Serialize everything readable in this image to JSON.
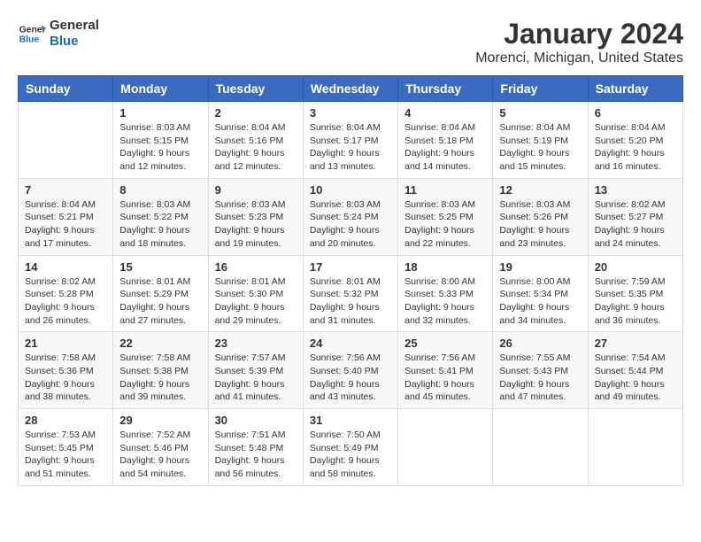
{
  "logo": {
    "line1": "General",
    "line2": "Blue"
  },
  "title": "January 2024",
  "subtitle": "Morenci, Michigan, United States",
  "headers": [
    "Sunday",
    "Monday",
    "Tuesday",
    "Wednesday",
    "Thursday",
    "Friday",
    "Saturday"
  ],
  "weeks": [
    [
      {
        "day": "",
        "info": ""
      },
      {
        "day": "1",
        "info": "Sunrise: 8:03 AM\nSunset: 5:15 PM\nDaylight: 9 hours\nand 12 minutes."
      },
      {
        "day": "2",
        "info": "Sunrise: 8:04 AM\nSunset: 5:16 PM\nDaylight: 9 hours\nand 12 minutes."
      },
      {
        "day": "3",
        "info": "Sunrise: 8:04 AM\nSunset: 5:17 PM\nDaylight: 9 hours\nand 13 minutes."
      },
      {
        "day": "4",
        "info": "Sunrise: 8:04 AM\nSunset: 5:18 PM\nDaylight: 9 hours\nand 14 minutes."
      },
      {
        "day": "5",
        "info": "Sunrise: 8:04 AM\nSunset: 5:19 PM\nDaylight: 9 hours\nand 15 minutes."
      },
      {
        "day": "6",
        "info": "Sunrise: 8:04 AM\nSunset: 5:20 PM\nDaylight: 9 hours\nand 16 minutes."
      }
    ],
    [
      {
        "day": "7",
        "info": "Sunrise: 8:04 AM\nSunset: 5:21 PM\nDaylight: 9 hours\nand 17 minutes."
      },
      {
        "day": "8",
        "info": "Sunrise: 8:03 AM\nSunset: 5:22 PM\nDaylight: 9 hours\nand 18 minutes."
      },
      {
        "day": "9",
        "info": "Sunrise: 8:03 AM\nSunset: 5:23 PM\nDaylight: 9 hours\nand 19 minutes."
      },
      {
        "day": "10",
        "info": "Sunrise: 8:03 AM\nSunset: 5:24 PM\nDaylight: 9 hours\nand 20 minutes."
      },
      {
        "day": "11",
        "info": "Sunrise: 8:03 AM\nSunset: 5:25 PM\nDaylight: 9 hours\nand 22 minutes."
      },
      {
        "day": "12",
        "info": "Sunrise: 8:03 AM\nSunset: 5:26 PM\nDaylight: 9 hours\nand 23 minutes."
      },
      {
        "day": "13",
        "info": "Sunrise: 8:02 AM\nSunset: 5:27 PM\nDaylight: 9 hours\nand 24 minutes."
      }
    ],
    [
      {
        "day": "14",
        "info": "Sunrise: 8:02 AM\nSunset: 5:28 PM\nDaylight: 9 hours\nand 26 minutes."
      },
      {
        "day": "15",
        "info": "Sunrise: 8:01 AM\nSunset: 5:29 PM\nDaylight: 9 hours\nand 27 minutes."
      },
      {
        "day": "16",
        "info": "Sunrise: 8:01 AM\nSunset: 5:30 PM\nDaylight: 9 hours\nand 29 minutes."
      },
      {
        "day": "17",
        "info": "Sunrise: 8:01 AM\nSunset: 5:32 PM\nDaylight: 9 hours\nand 31 minutes."
      },
      {
        "day": "18",
        "info": "Sunrise: 8:00 AM\nSunset: 5:33 PM\nDaylight: 9 hours\nand 32 minutes."
      },
      {
        "day": "19",
        "info": "Sunrise: 8:00 AM\nSunset: 5:34 PM\nDaylight: 9 hours\nand 34 minutes."
      },
      {
        "day": "20",
        "info": "Sunrise: 7:59 AM\nSunset: 5:35 PM\nDaylight: 9 hours\nand 36 minutes."
      }
    ],
    [
      {
        "day": "21",
        "info": "Sunrise: 7:58 AM\nSunset: 5:36 PM\nDaylight: 9 hours\nand 38 minutes."
      },
      {
        "day": "22",
        "info": "Sunrise: 7:58 AM\nSunset: 5:38 PM\nDaylight: 9 hours\nand 39 minutes."
      },
      {
        "day": "23",
        "info": "Sunrise: 7:57 AM\nSunset: 5:39 PM\nDaylight: 9 hours\nand 41 minutes."
      },
      {
        "day": "24",
        "info": "Sunrise: 7:56 AM\nSunset: 5:40 PM\nDaylight: 9 hours\nand 43 minutes."
      },
      {
        "day": "25",
        "info": "Sunrise: 7:56 AM\nSunset: 5:41 PM\nDaylight: 9 hours\nand 45 minutes."
      },
      {
        "day": "26",
        "info": "Sunrise: 7:55 AM\nSunset: 5:43 PM\nDaylight: 9 hours\nand 47 minutes."
      },
      {
        "day": "27",
        "info": "Sunrise: 7:54 AM\nSunset: 5:44 PM\nDaylight: 9 hours\nand 49 minutes."
      }
    ],
    [
      {
        "day": "28",
        "info": "Sunrise: 7:53 AM\nSunset: 5:45 PM\nDaylight: 9 hours\nand 51 minutes."
      },
      {
        "day": "29",
        "info": "Sunrise: 7:52 AM\nSunset: 5:46 PM\nDaylight: 9 hours\nand 54 minutes."
      },
      {
        "day": "30",
        "info": "Sunrise: 7:51 AM\nSunset: 5:48 PM\nDaylight: 9 hours\nand 56 minutes."
      },
      {
        "day": "31",
        "info": "Sunrise: 7:50 AM\nSunset: 5:49 PM\nDaylight: 9 hours\nand 58 minutes."
      },
      {
        "day": "",
        "info": ""
      },
      {
        "day": "",
        "info": ""
      },
      {
        "day": "",
        "info": ""
      }
    ]
  ]
}
